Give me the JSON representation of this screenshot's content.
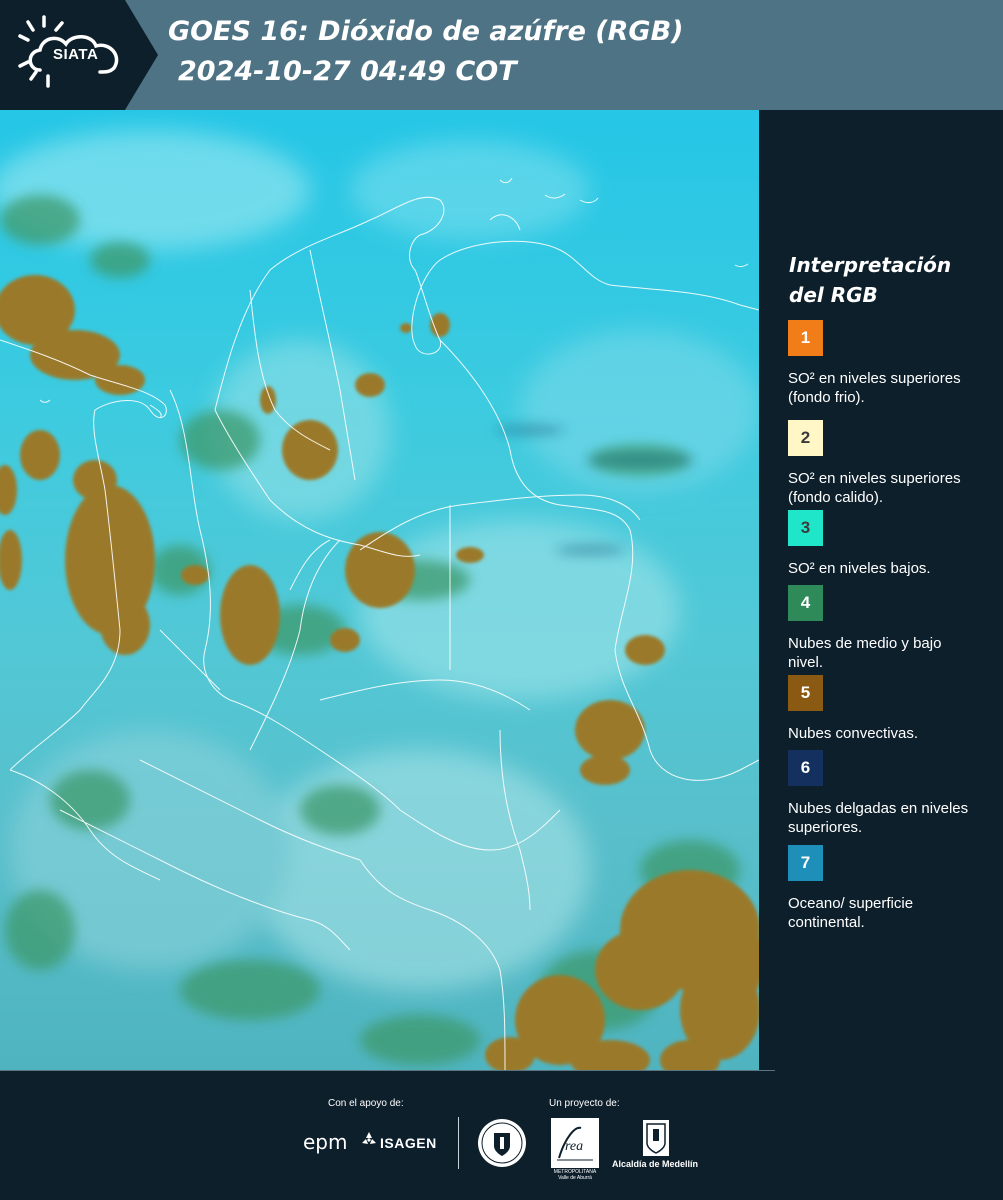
{
  "header": {
    "logo_text": "SIATA",
    "title_line1": "GOES 16: Dióxido de azúfre (RGB)",
    "title_line2": "2024-10-27 04:49 COT",
    "background_color": "#4e7384"
  },
  "legend": {
    "title_line1": "Interpretación",
    "title_line2": "del RGB",
    "items": [
      {
        "number": "1",
        "color": "#f07d17",
        "number_color": "#ffffff",
        "text": "SO² en niveles superiores (fondo frio)."
      },
      {
        "number": "2",
        "color": "#fff7c6",
        "number_color": "#3a3a3a",
        "text": "SO² en niveles superiores (fondo calido)."
      },
      {
        "number": "3",
        "color": "#1fe6c9",
        "number_color": "#3a3a3a",
        "text": "SO² en niveles bajos."
      },
      {
        "number": "4",
        "color": "#2f8a5a",
        "number_color": "#ffffff",
        "text": "Nubes de medio y bajo nivel."
      },
      {
        "number": "5",
        "color": "#8a5a12",
        "number_color": "#ffffff",
        "text": "Nubes convectivas."
      },
      {
        "number": "6",
        "color": "#14305e",
        "number_color": "#ffffff",
        "text": "Nubes delgadas en niveles superiores."
      },
      {
        "number": "7",
        "color": "#1e8fb9",
        "number_color": "#ffffff",
        "text": "Oceano/ superficie continental."
      }
    ]
  },
  "footer": {
    "support_label": "Con el apoyo de:",
    "project_label": "Un proyecto de:",
    "sponsors": [
      "epm",
      "ISAGEN"
    ],
    "partners": [
      "Área Metropolitana Valle de Aburrá",
      "Alcaldía de Medellín"
    ],
    "area_text": "METROPOLITANA Valle de Aburrá",
    "alcaldia_text": "Alcaldía de Medellín"
  }
}
